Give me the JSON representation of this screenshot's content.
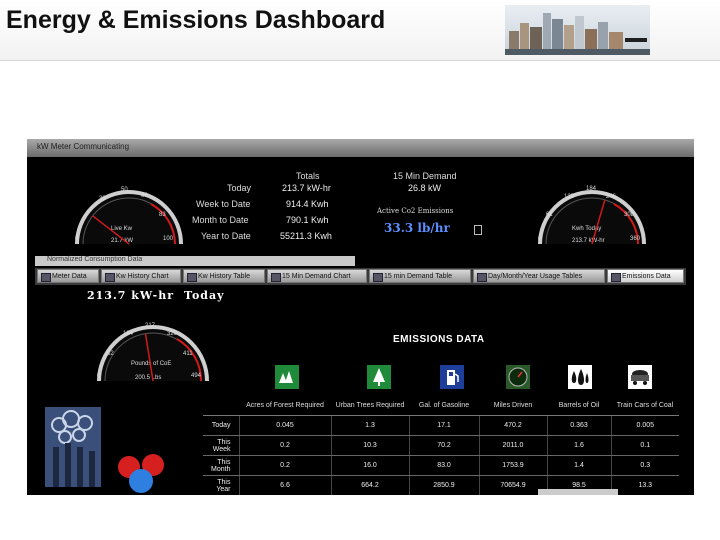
{
  "page": {
    "title": "Energy & Emissions Dashboard"
  },
  "window": {
    "title": "kW Meter Communicating"
  },
  "gauges": {
    "left": {
      "ticks": [
        "0",
        "33",
        "50",
        "66",
        "83",
        "100"
      ],
      "label": "Live Kw",
      "reading": "21.7 kW",
      "value_fraction": 0.21
    },
    "right": {
      "ticks": [
        "0",
        "61",
        "123",
        "184",
        "246",
        "308",
        "360"
      ],
      "label": "Kwh Today",
      "reading": "213.7 kW-hr",
      "value_fraction": 0.59
    },
    "bottom": {
      "ticks": [
        "0",
        "62",
        "164",
        "217",
        "320",
        "411",
        "494"
      ],
      "label": "Pounds of CoE",
      "reading": "200.5 Lbs",
      "value_fraction": 0.45
    }
  },
  "totals": {
    "header": "Totals",
    "rows": [
      {
        "label": "Today",
        "value": "213.7 kW-hr"
      },
      {
        "label": "Week to Date",
        "value": "914.4 Kwh"
      },
      {
        "label": "Month to Date",
        "value": "790.1 Kwh"
      },
      {
        "label": "Year to Date",
        "value": "55211.3 Kwh"
      }
    ]
  },
  "demand": {
    "header": "15 Min Demand",
    "value": "26.8 kW",
    "emissions_label": "Active Co2 Emissions",
    "emissions_value": "33.3 lb/hr"
  },
  "subpanel": {
    "label": "Normalized Consumption Data"
  },
  "tabs": [
    {
      "label": "Meter Data",
      "active": false
    },
    {
      "label": "Kw History Chart",
      "active": false
    },
    {
      "label": "Kw History Table",
      "active": false
    },
    {
      "label": "15 Min Demand Chart",
      "active": false
    },
    {
      "label": "15 min Demand Table",
      "active": false
    },
    {
      "label": "Day/Month/Year Usage Tables",
      "active": false
    },
    {
      "label": "Emissions Data",
      "active": true
    }
  ],
  "reading_banner": {
    "value": "213.7 kW-hr",
    "period": "Today"
  },
  "emissions": {
    "title": "EMISSIONS DATA",
    "columns": [
      "Acres of Forest Required",
      "Urban Trees Required",
      "Gal. of Gasoline",
      "Miles Driven",
      "Barrels of Oil",
      "Train Cars of Coal"
    ],
    "icons": [
      "forest-icon",
      "tree-icon",
      "gas-pump-icon",
      "speedometer-icon",
      "oil-drops-icon",
      "coal-car-icon"
    ],
    "rows": [
      {
        "label": "Today",
        "values": [
          "0.045",
          "1.3",
          "17.1",
          "470.2",
          "0.363",
          "0.005"
        ]
      },
      {
        "label": "This Week",
        "values": [
          "0.2",
          "10.3",
          "70.2",
          "2011.0",
          "1.6",
          "0.1"
        ]
      },
      {
        "label": "This Month",
        "values": [
          "0.2",
          "16.0",
          "83.0",
          "1753.9",
          "1.4",
          "0.3"
        ]
      },
      {
        "label": "This Year",
        "values": [
          "6.6",
          "664.2",
          "2850.9",
          "70654.9",
          "98.5",
          "13.3"
        ]
      }
    ]
  },
  "colors": {
    "panel_bg": "#000000",
    "needle": "#d11a1a",
    "emissions_value": "#5b8fff"
  }
}
